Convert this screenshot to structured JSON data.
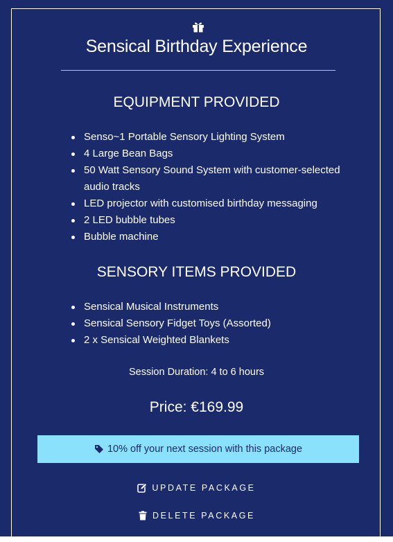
{
  "package": {
    "icon": "gift-icon",
    "title": "Sensical Birthday Experience",
    "equipment_heading": "EQUIPMENT PROVIDED",
    "equipment_items": [
      "Senso~1 Portable Sensory Lighting System",
      "4 Large Bean Bags",
      "50 Watt Sensory Sound System with customer-selected audio tracks",
      "LED projector with customised birthday messaging",
      "2 LED bubble tubes",
      "Bubble machine"
    ],
    "sensory_heading": "SENSORY ITEMS PROVIDED",
    "sensory_items": [
      "Sensical Musical Instruments",
      "Sensical Sensory Fidget Toys (Assorted)",
      "2 x Sensical Weighted Blankets"
    ],
    "duration": "Session Duration: 4 to 6 hours",
    "price": "Price: €169.99",
    "promo": "10% off your next session with this package",
    "promo_icon": "tag-icon"
  },
  "actions": {
    "update_label": "UPDATE PACKAGE",
    "update_icon": "edit-icon",
    "delete_label": "DELETE PACKAGE",
    "delete_icon": "trash-icon"
  },
  "colors": {
    "background": "#1a2a6b",
    "accent": "#89e1fb",
    "divider": "#8fd8f4",
    "text": "#ffffff"
  }
}
